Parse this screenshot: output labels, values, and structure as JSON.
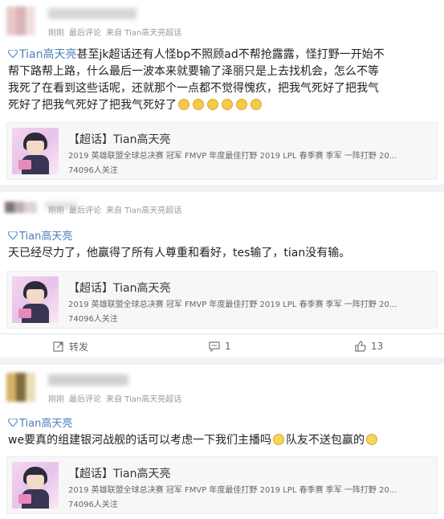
{
  "posts": [
    {
      "meta": {
        "time": "刚刚",
        "last_comment": "最后评论",
        "source": "来自 Tian高天亮超话"
      },
      "tag": "Tian高天亮",
      "text_lines": [
        "甚至jk超话还有人怪bp不照顾ad不帮抢露露，怪打野一开始不",
        "帮下路帮上路，什么最后一波本来就要输了泽丽只是上去找机会，怎么不等",
        "我死了在看到这些话呢，还就那个一点都不觉得愧疚，把我气死好了把我气",
        "死好了把我气死好了把我气死好了"
      ],
      "card": {
        "title": "【超话】Tian高天亮",
        "subtitle": "2019 英雄联盟全球总决赛 冠军 FMVP 年度最佳打野 2019 LPL 春季赛 季军 一阵打野 20...",
        "followers": "74096人关注"
      }
    },
    {
      "meta": {
        "time": "刚刚",
        "last_comment": "最后评论",
        "source": "来自 Tian高天亮超话"
      },
      "tag": "Tian高天亮",
      "text_lines": [
        "天已经尽力了，他赢得了所有人尊重和看好，tes输了，tian没有输。"
      ],
      "card": {
        "title": "【超话】Tian高天亮",
        "subtitle": "2019 英雄联盟全球总决赛 冠军 FMVP 年度最佳打野 2019 LPL 春季赛 季军 一阵打野 20...",
        "followers": "74096人关注"
      },
      "actions": {
        "repost": "转发",
        "comments": "1",
        "likes": "13"
      }
    },
    {
      "meta": {
        "time": "刚刚",
        "last_comment": "最后评论",
        "source": "来自 Tian高天亮超话"
      },
      "tag": "Tian高天亮",
      "text_lines": [
        "we要真的组建银河战舰的话可以考虑一下我们主播吗",
        "队友不送包赢的"
      ],
      "card": {
        "title": "【超话】Tian高天亮",
        "subtitle": "2019 英雄联盟全球总决赛 冠军 FMVP 年度最佳打野 2019 LPL 春季赛 季军 一阵打野 20...",
        "followers": "74096人关注"
      }
    }
  ],
  "colors": {
    "link": "#4a7fb5",
    "separator": "#f2f2f5",
    "meta": "#999999"
  }
}
